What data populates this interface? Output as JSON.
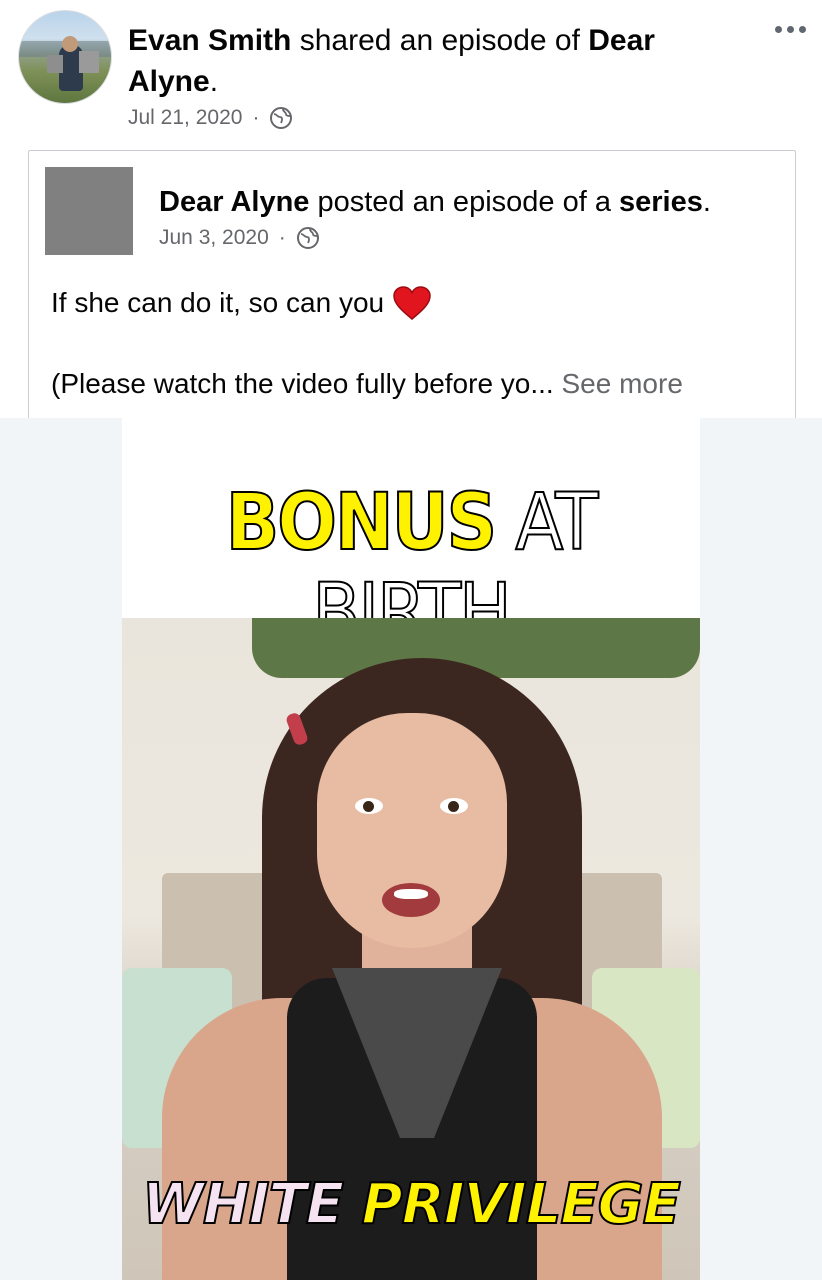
{
  "share": {
    "author": "Evan Smith",
    "action": " shared an episode of ",
    "page_name": "Dear Alyne",
    "suffix": ".",
    "date": "Jul 21, 2020",
    "separator": "·",
    "privacy_icon": "globe-icon",
    "more_icon": "more-horizontal-icon"
  },
  "original_post": {
    "page_name": "Dear Alyne",
    "action": " posted an episode of a ",
    "object": "series",
    "suffix": ".",
    "date": "Jun 3, 2020",
    "separator": "·",
    "privacy_icon": "globe-icon",
    "text_line1": "If she can do it, so can you",
    "emoji": "heart-emoji",
    "text_line2": "(Please watch the video fully before yo...",
    "see_more": " See more"
  },
  "video": {
    "title_highlight": "BONUS",
    "title_rest": " AT BIRTH",
    "caption_part1": "WHITE ",
    "caption_part2": "PRIVILEGE",
    "colors": {
      "highlight": "#fff200",
      "caption_white": "#f6e3f2"
    }
  }
}
